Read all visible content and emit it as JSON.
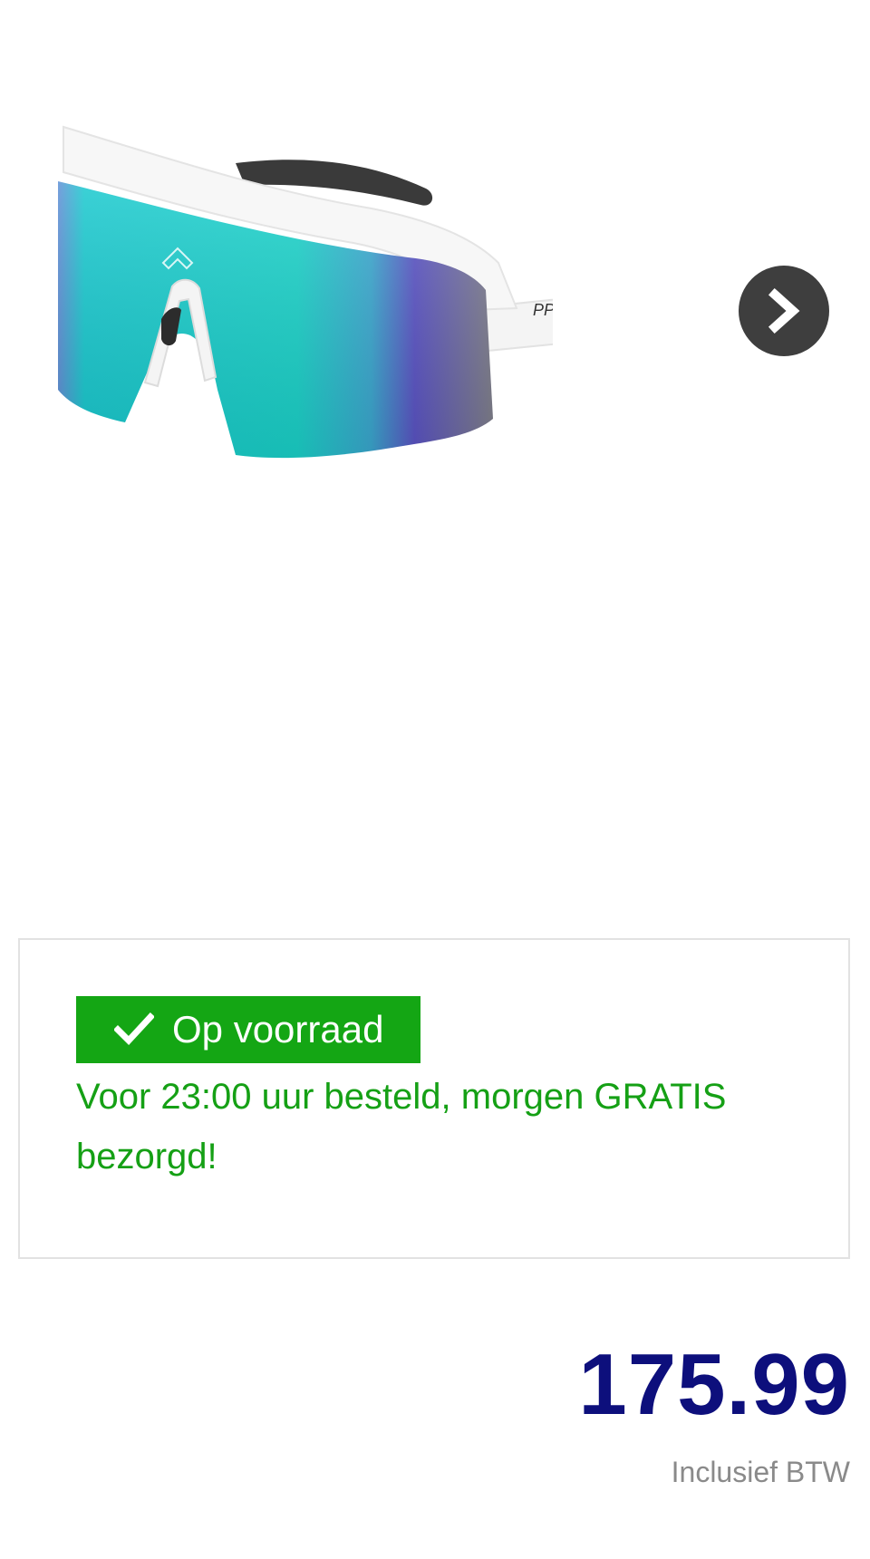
{
  "product": {
    "brand_on_frame": "PPEEQQ",
    "image_name": "sunglasses-product-image"
  },
  "gallery": {
    "next_icon": "chevron-right-icon"
  },
  "stock": {
    "badge_icon": "check-icon",
    "badge_label": "Op voorraad",
    "delivery_message": "Voor 23:00 uur besteld, morgen GRATIS bezorgd!",
    "badge_color": "#14a614",
    "text_color": "#15a015"
  },
  "pricing": {
    "price": "175.99",
    "vat_note": "Inclusief BTW",
    "price_color": "#0d0f7c"
  }
}
